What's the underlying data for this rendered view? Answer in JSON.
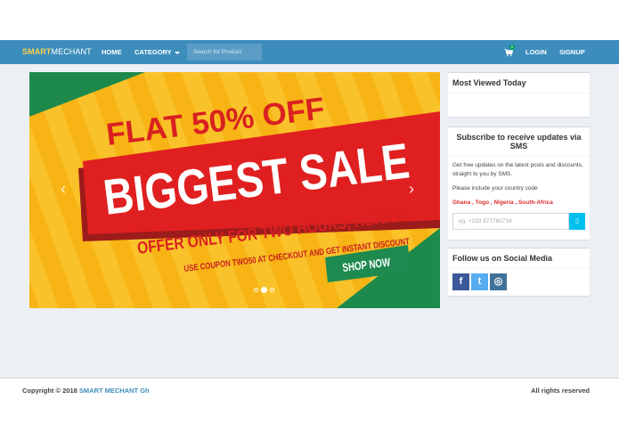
{
  "navbar": {
    "brand_bold": "SMART",
    "brand_rest": "MECHANT",
    "home": "HOME",
    "category": "CATEGORY",
    "search_placeholder": "Search for Product",
    "cart_count": "0",
    "login": "LOGIN",
    "signup": "SIGNUP"
  },
  "banner": {
    "line1": "FLAT 50% OFF",
    "line2": "BIGGEST SALE",
    "line3": "OFFER ONLY FOR TWO HOURS, HURRY!",
    "line4": "USE COUPON TWO50 AT CHECKOUT AND GET INSTANT DISCOUNT",
    "cta": "SHOP NOW",
    "prev": "‹",
    "next": "›",
    "active_slide": 2,
    "slide_count": 3
  },
  "most_viewed": {
    "title": "Most Viewed Today"
  },
  "sms": {
    "title": "Subscribe to receive updates via SMS",
    "desc": "Get free updates on the latest posts and discounts, straight to you by SMS.",
    "include": "Please include your country code",
    "countries": "Ghana , Togo , Nigeria , South-Africa",
    "placeholder": "eg. +233 577760734",
    "button_icon": "mobile-icon",
    "button": "▯"
  },
  "social": {
    "title": "Follow us on Social Media",
    "facebook": "f",
    "twitter": "t",
    "instagram": "◎",
    "colors": {
      "facebook": "#3b5998",
      "twitter": "#55acee",
      "instagram": "#3f729b"
    }
  },
  "footer": {
    "copyright": "Copyright © 2018",
    "brand": "SMART MECHANT Gh",
    "rights": "All rights reserved"
  },
  "colors": {
    "navbar": "#3c8dbc",
    "brand_accent": "#f6d24c",
    "background": "#ecf0f5"
  }
}
